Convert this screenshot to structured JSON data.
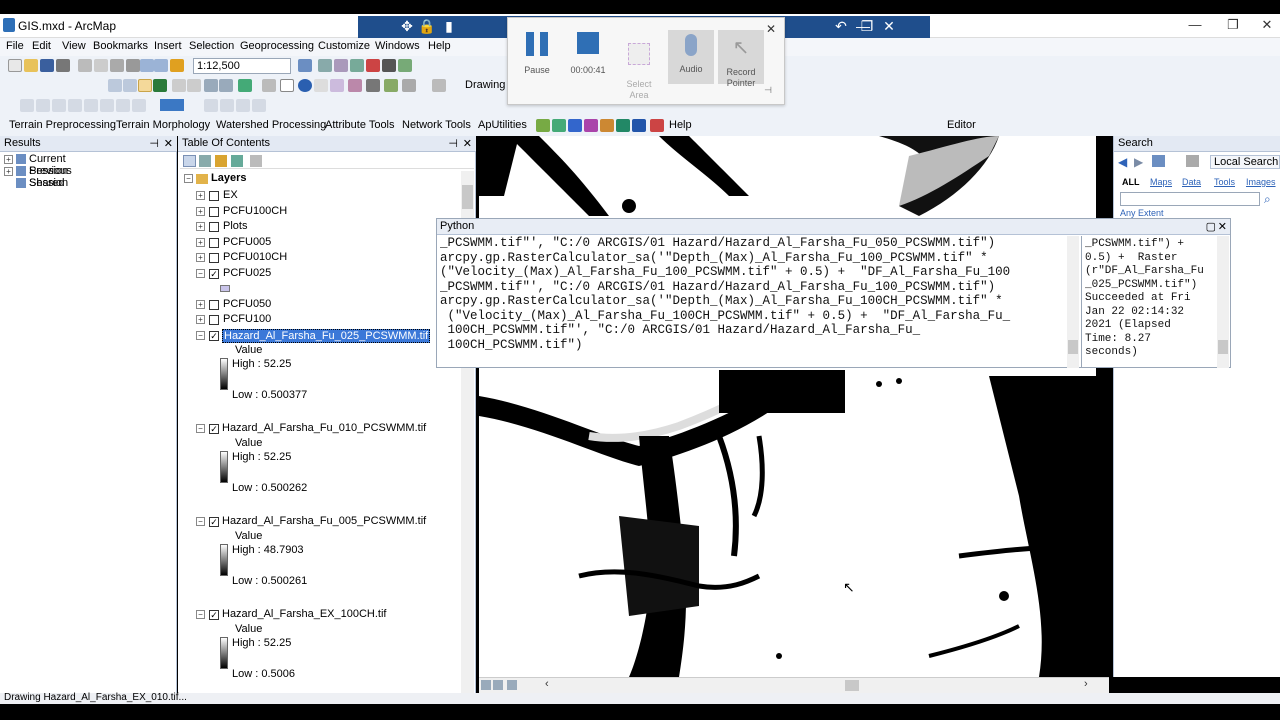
{
  "app": {
    "title": "GIS.mxd - ArcMap"
  },
  "menu": [
    "File",
    "Edit",
    "View",
    "Bookmarks",
    "Insert",
    "Selection",
    "Geoprocessing",
    "Customize",
    "Windows",
    "Help"
  ],
  "toolbar": {
    "scale": "1:12,500",
    "drawing_label": "Drawing",
    "editor_label": "Editor",
    "help_label": "Help",
    "extensions": [
      "Terrain Preprocessing",
      "Terrain Morphology",
      "Watershed Processing",
      "Attribute Tools",
      "Network Tools",
      "ApUtilities"
    ]
  },
  "recorder": {
    "pause_label": "Pause",
    "time": "00:00:41",
    "select_area_label": "Select\nArea",
    "audio_label": "Audio",
    "record_pointer_label": "Record\nPointer"
  },
  "results": {
    "title": "Results",
    "items": [
      "Current Session",
      "Previous Session",
      "Shared"
    ]
  },
  "toc": {
    "title": "Table Of Contents",
    "root": "Layers",
    "layers": [
      {
        "name": "EX",
        "checked": false
      },
      {
        "name": "PCFU100CH",
        "checked": false
      },
      {
        "name": "Plots",
        "checked": false
      },
      {
        "name": "PCFU005",
        "checked": false
      },
      {
        "name": "PCFU010CH",
        "checked": false
      },
      {
        "name": "PCFU025",
        "checked": true
      },
      {
        "name": "PCFU050",
        "checked": false
      },
      {
        "name": "PCFU100",
        "checked": false
      }
    ],
    "rasters": [
      {
        "name": "Hazard_Al_Farsha_Fu_025_PCSWMM.tif",
        "value_label": "Value",
        "high": "High : 52.25",
        "low": "Low : 0.500377"
      },
      {
        "name": "Hazard_Al_Farsha_Fu_010_PCSWMM.tif",
        "value_label": "Value",
        "high": "High : 52.25",
        "low": "Low : 0.500262"
      },
      {
        "name": "Hazard_Al_Farsha_Fu_005_PCSWMM.tif",
        "value_label": "Value",
        "high": "High : 48.7903",
        "low": "Low : 0.500261"
      },
      {
        "name": "Hazard_Al_Farsha_EX_100CH.tif",
        "value_label": "Value",
        "high": "High : 52.25",
        "low": "Low : 0.5006"
      }
    ]
  },
  "python": {
    "title": "Python",
    "code": "_PCSWMM.tif\"', \"C:/0 ARCGIS/01 Hazard/Hazard_Al_Farsha_Fu_050_PCSWMM.tif\")\narcpy.gp.RasterCalculator_sa('\"Depth_(Max)_Al_Farsha_Fu_100_PCSWMM.tif\" *\n(\"Velocity_(Max)_Al_Farsha_Fu_100_PCSWMM.tif\" + 0.5) +  \"DF_Al_Farsha_Fu_100\n_PCSWMM.tif\"', \"C:/0 ARCGIS/01 Hazard/Hazard_Al_Farsha_Fu_100_PCSWMM.tif\")\narcpy.gp.RasterCalculator_sa('\"Depth_(Max)_Al_Farsha_Fu_100CH_PCSWMM.tif\" *\n (\"Velocity_(Max)_Al_Farsha_Fu_100CH_PCSWMM.tif\" + 0.5) +  \"DF_Al_Farsha_Fu_\n 100CH_PCSWMM.tif\"', \"C:/0 ARCGIS/01 Hazard/Hazard_Al_Farsha_Fu_\n 100CH_PCSWMM.tif\")",
    "output": "_PCSWMM.tif\") +\n0.5) +  Raster\n(r\"DF_Al_Farsha_Fu\n_025_PCSWMM.tif\")\nSucceeded at Fri\nJan 22 02:14:32\n2021 (Elapsed\nTime: 8.27\nseconds)"
  },
  "search": {
    "title": "Search",
    "local_search": "Local Search",
    "tabs": [
      "ALL",
      "Maps",
      "Data",
      "Tools",
      "Images"
    ],
    "any_extent": "Any Extent"
  },
  "status": {
    "text": "Drawing Hazard_Al_Farsha_EX_010.tif..."
  }
}
